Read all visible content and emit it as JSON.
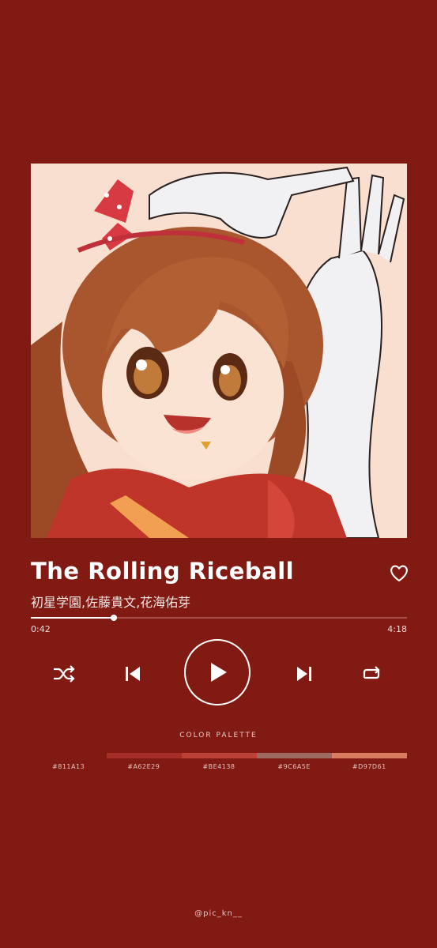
{
  "song": {
    "title": "The Rolling Riceball",
    "artist": "初星学園,佐藤貴文,花海佑芽"
  },
  "player": {
    "current_time": "0:42",
    "total_time": "4:18",
    "progress_fraction": 0.221
  },
  "palette": {
    "label": "COLOR PALETTE",
    "colors": [
      "#811A13",
      "#A62E29",
      "#BE4138",
      "#9C6A5E",
      "#D97D61"
    ]
  },
  "icons": {
    "like": "heart-icon",
    "shuffle": "shuffle-icon",
    "previous": "skip-previous-icon",
    "play": "play-icon",
    "next": "skip-next-icon",
    "repeat": "repeat-icon"
  },
  "credit": "@pic_kn__"
}
